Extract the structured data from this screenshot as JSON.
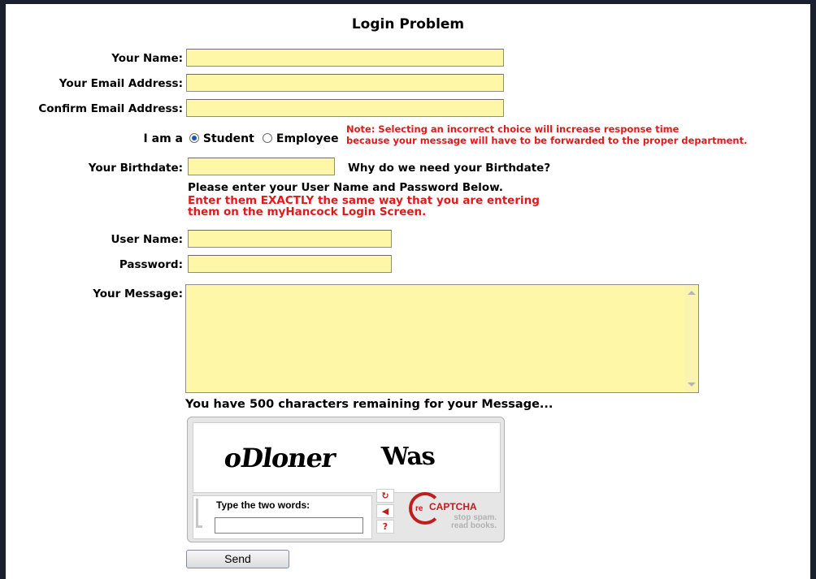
{
  "title": "Login Problem",
  "form": {
    "name_label": "Your Name:",
    "email_label": "Your Email Address:",
    "confirm_email_label": "Confirm Email Address:",
    "iam_label": "I am a",
    "role_options": [
      {
        "label": "Student",
        "selected": true
      },
      {
        "label": "Employee",
        "selected": false
      }
    ],
    "role_note_line1": "Note: Selecting an incorrect choice will increase response time",
    "role_note_line2": "because your message will have to be forwarded to the proper department.",
    "birthdate_label": "Your Birthdate:",
    "birthdate_help": "Why do we need your Birthdate?",
    "credentials_intro": "Please enter your User Name and Password Below.",
    "credentials_warning_line1": "Enter them EXACTLY the same way that you are entering",
    "credentials_warning_line2": "them on the myHancock Login Screen.",
    "username_label": "User Name:",
    "password_label": "Password:",
    "message_label": "Your Message:",
    "chars_remaining": "You have 500 characters remaining for your Message..."
  },
  "captcha": {
    "word1": "oDloner",
    "word2": "Was",
    "prompt": "Type the two words:",
    "brand": "CAPTCHA",
    "brand_prefix": "re",
    "tagline_line1": "stop spam.",
    "tagline_line2": "read books."
  },
  "send_label": "Send",
  "colors": {
    "field_bg": "#fff7a8",
    "warning_red": "#e01a1a",
    "frame": "#1b1f2e"
  }
}
